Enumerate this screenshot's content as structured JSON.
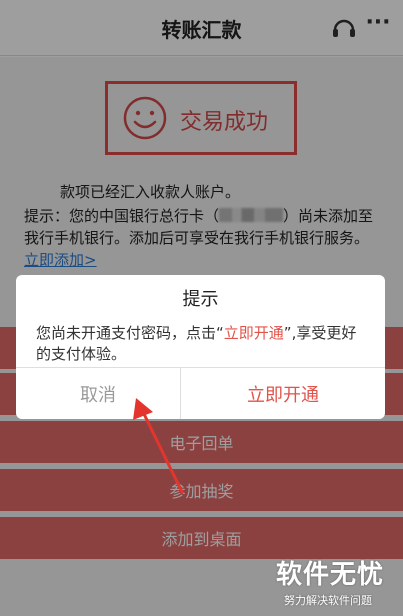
{
  "header": {
    "title": "转账汇款",
    "service_icon": "headset-icon",
    "more_label": "···"
  },
  "result": {
    "icon": "smile-icon",
    "status": "交易成功",
    "credited": "款项已经汇入收款人账户。",
    "tip_prefix": "提示：您的中国银行总行卡（",
    "tip_suffix": "）尚未添加至我行手机银行。添加后可享受在我行手机银行服务。",
    "tip_link": "立即添加>"
  },
  "actions": {
    "b1": "",
    "b2": "",
    "b3": "电子回单",
    "b4": "参加抽奖",
    "b5": "添加到桌面"
  },
  "dialog": {
    "title": "提示",
    "msg_before": "您尚未开通支付密码，点击“",
    "msg_highlight": "立即开通",
    "msg_after": "”,享受更好的支付体验。",
    "cancel": "取消",
    "confirm": "立即开通"
  },
  "watermark": {
    "title": "软件无忧",
    "subtitle": "努力解决软件问题"
  },
  "colors": {
    "accent": "#e2534a",
    "button_bg": "#e26a6a",
    "link": "#2d7bd2"
  }
}
